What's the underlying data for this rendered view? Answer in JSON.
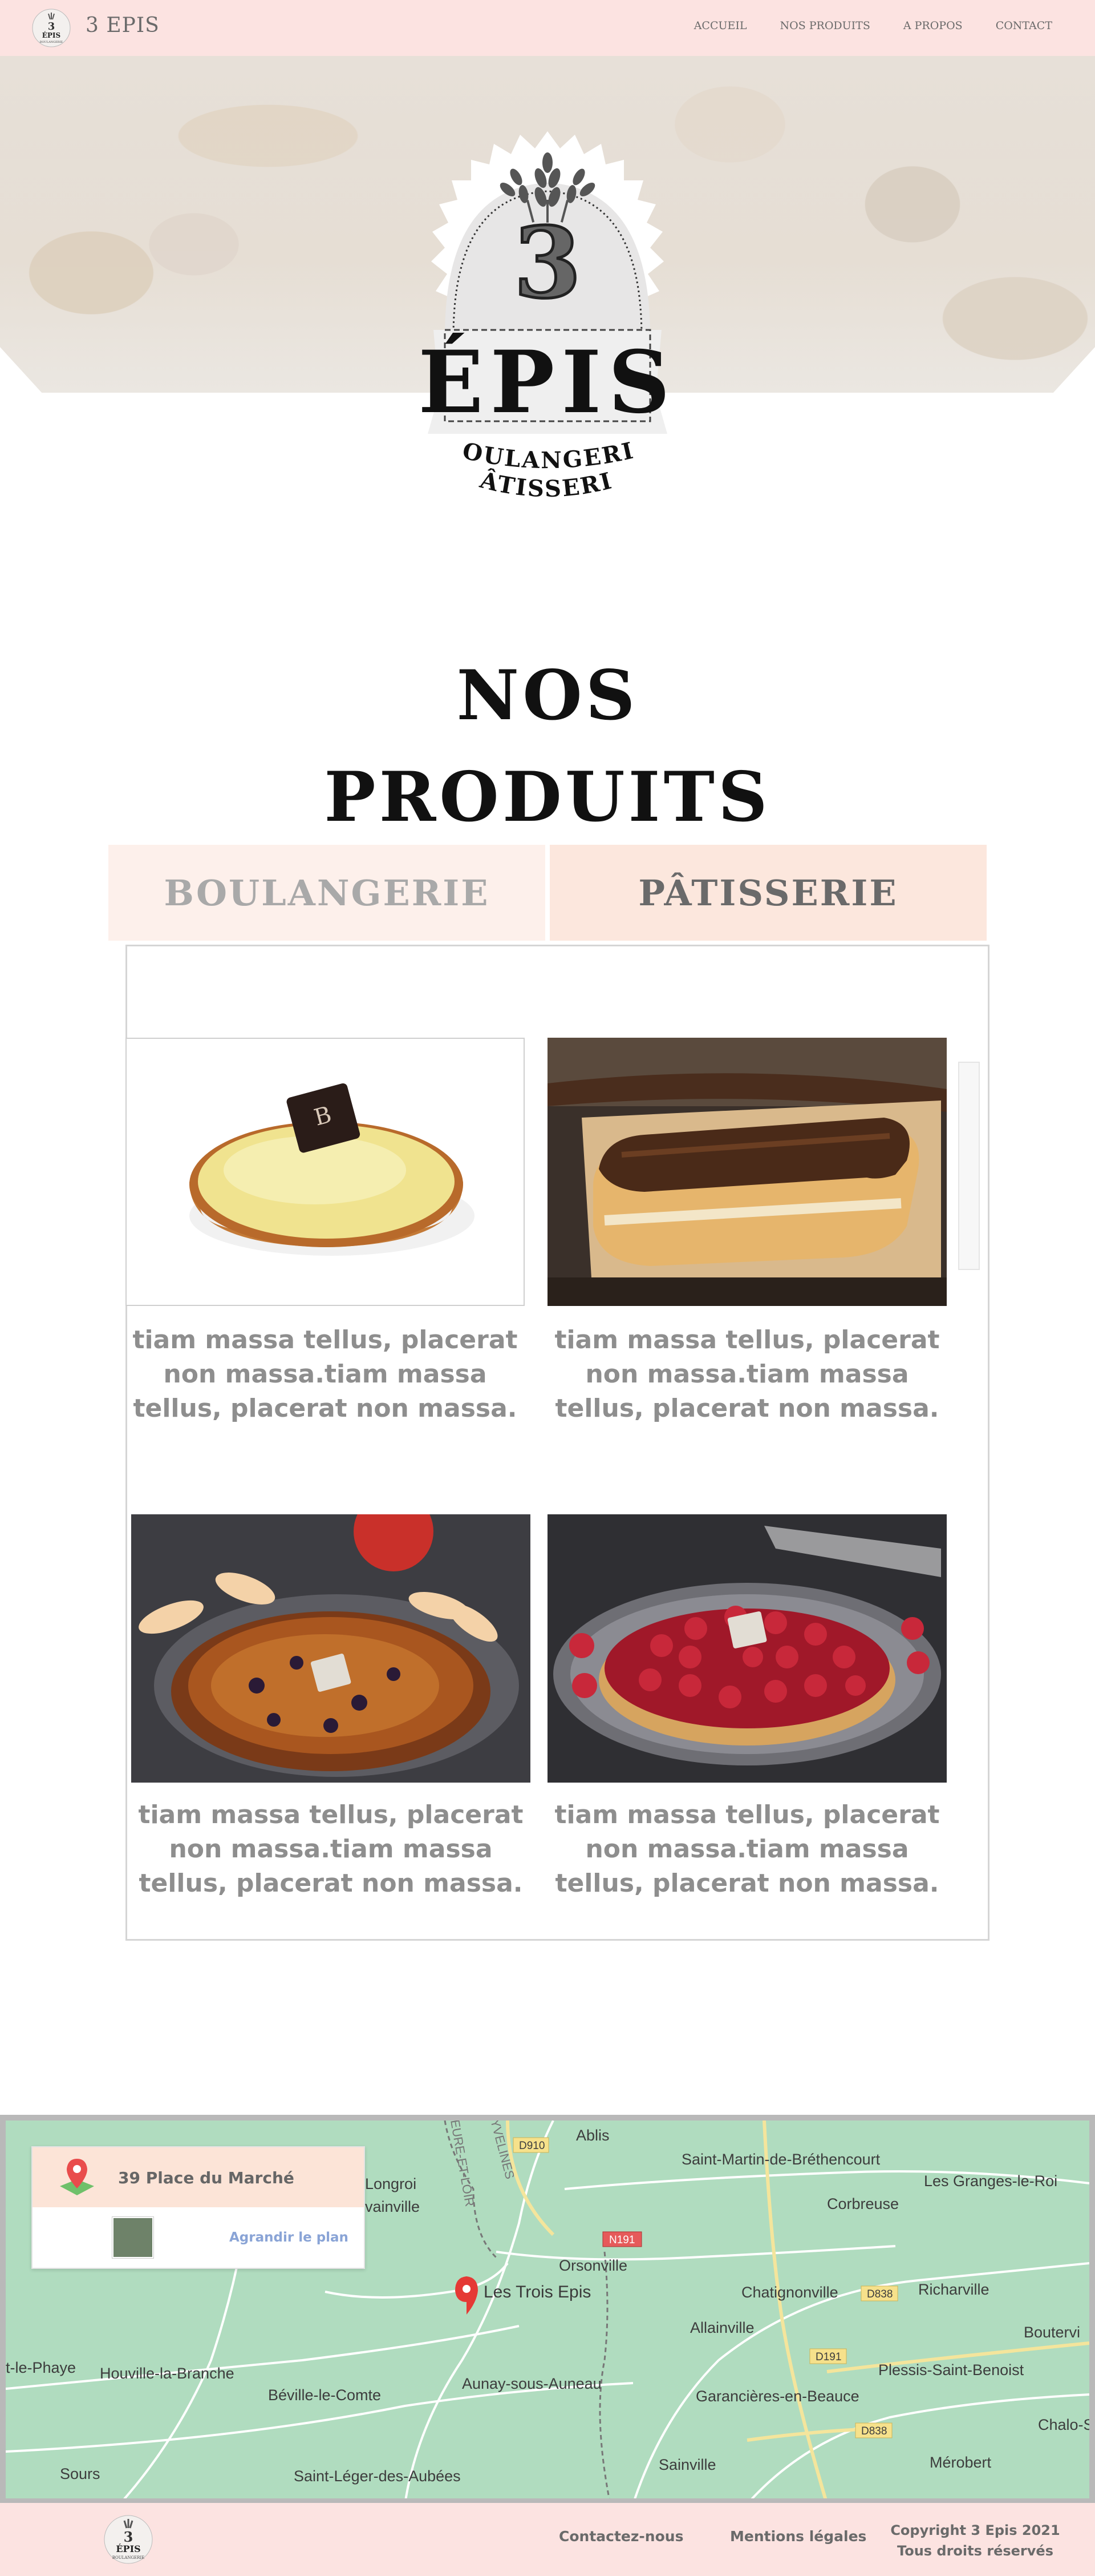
{
  "header": {
    "brand": "3 EPIS",
    "nav": [
      "ACCUEIL",
      "NOS PRODUITS",
      "A PROPOS",
      "CONTACT"
    ]
  },
  "hero": {
    "logo_number": "3",
    "logo_word": "ÉPIS",
    "logo_line1": "BOULANGERIE",
    "logo_line2": "PÂTISSERIE"
  },
  "section": {
    "title_line1": "NOS",
    "title_line2": "PRODUITS"
  },
  "tabs": [
    {
      "label": "BOULANGERIE",
      "active": false
    },
    {
      "label": "PÂTISSERIE",
      "active": true
    }
  ],
  "products": [
    {
      "name": "tarte-citron",
      "text": "tiam massa tellus, placerat non massa.tiam massa tellus, placerat non massa."
    },
    {
      "name": "eclair-chocolat",
      "text": "tiam massa tellus, placerat non massa.tiam massa tellus, placerat non massa."
    },
    {
      "name": "tarte-pomme",
      "text": "tiam massa tellus, placerat non massa.tiam massa tellus, placerat non massa."
    },
    {
      "name": "tarte-framboise",
      "text": "tiam massa tellus, placerat non massa.tiam massa tellus, placerat non massa."
    }
  ],
  "map": {
    "address": "39 Place du Marché",
    "enlarge": "Agrandir le plan",
    "pin_label": "Les Trois Epis",
    "places": [
      "Ablis",
      "Saint-Martin-de-Bréthencourt",
      "Longroi",
      "vainville",
      "Corbreuse",
      "Les Granges-le-Roi",
      "Orsonville",
      "Richarville",
      "Chatignonville",
      "Allainville",
      "t-le-Phaye",
      "Houville-la-Branche",
      "Plessis-Saint-Benoist",
      "Béville-le-Comte",
      "Aunay-sous-Auneau",
      "Garancières-en-Beauce",
      "Boutervi",
      "Chalo-S",
      "Sours",
      "Saint-Léger-des-Aubées",
      "Sainville",
      "Mérobert",
      "EURE-ET-LOIR",
      "YVELINES"
    ],
    "roads": [
      "D910",
      "N191",
      "D838",
      "D191",
      "D838"
    ]
  },
  "footer": {
    "contact": "Contactez-nous",
    "legal": "Mentions légales",
    "copyright_line1": "Copyright 3 Epis 2021",
    "copyright_line2": "Tous droits réservés"
  }
}
